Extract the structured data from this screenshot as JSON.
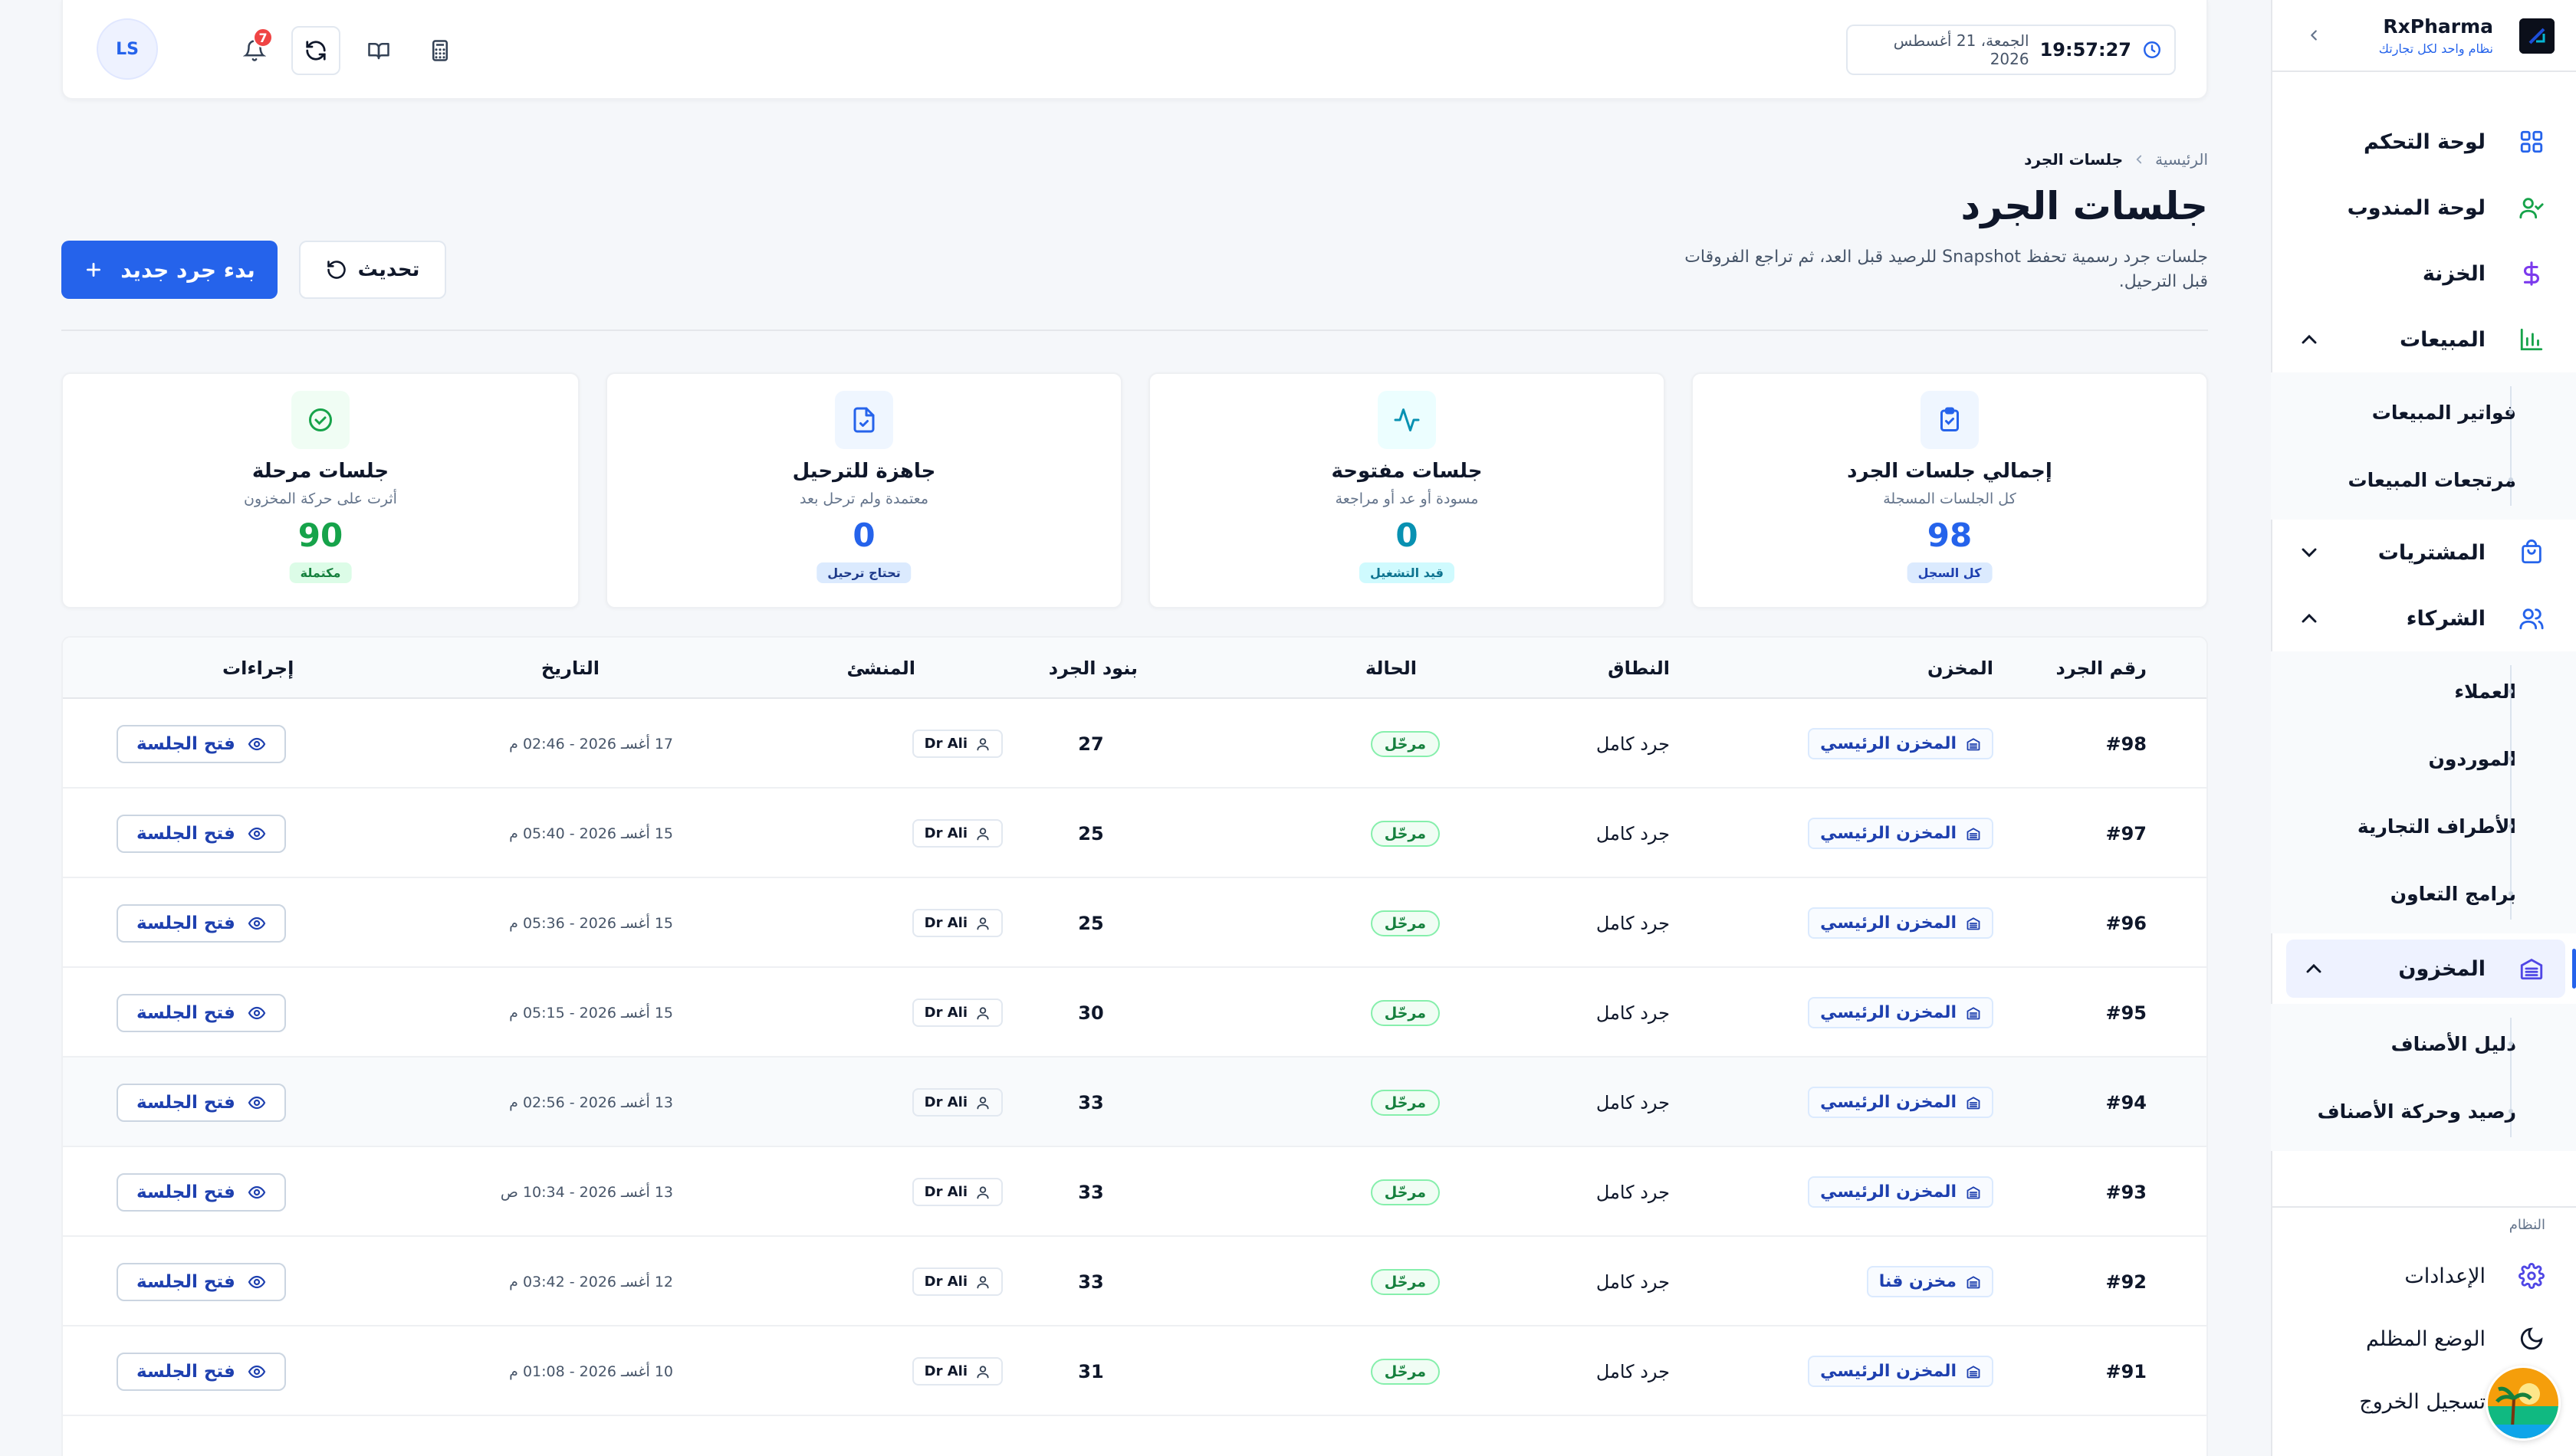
{
  "brand": {
    "name": "RxPharma",
    "tagline": "نظام واحد لكل تجارتك"
  },
  "nav": {
    "dashboard": "لوحة التحكم",
    "rep_dashboard": "لوحة المندوب",
    "treasury": "الخزنة",
    "sales": "المبيعات",
    "sales_items": [
      "فواتير المبيعات",
      "مرتجعات المبيعات"
    ],
    "purchases": "المشتريات",
    "partners": "الشركاء",
    "partners_items": [
      "العملاء",
      "الموردون",
      "الأطراف التجارية",
      "برامج التعاون"
    ],
    "inventory": "المخزون",
    "inventory_items": [
      "دليل الأصناف",
      "رصيد وحركة الأصناف"
    ],
    "system_label": "النظام",
    "settings": "الإعدادات",
    "dark_mode": "الوضع المظلم",
    "logout": "تسجيل الخروج"
  },
  "topbar": {
    "time": "19:57:27",
    "date": "الجمعة، 21 أغسطس 2026",
    "notifications_count": "7",
    "user_initials": "LS"
  },
  "page": {
    "breadcrumb_home": "الرئيسية",
    "breadcrumb_current": "جلسات الجرد",
    "title": "جلسات الجرد",
    "description": "جلسات جرد رسمية تحفظ Snapshot للرصيد قبل العد، ثم تراجع الفروقات قبل الترحيل.",
    "new_count_button": "بدء جرد جديد",
    "refresh_button": "تحديث"
  },
  "stats": [
    {
      "title": "إجمالي جلسات الجرد",
      "subtitle": "كل الجلسات المسجلة",
      "value": "98",
      "pill": "كل السجل",
      "color": "#2563eb",
      "bg": "#eff6ff",
      "pill_bg": "#dbeafe",
      "pill_color": "#1e40af",
      "icon": "clipboard-icon"
    },
    {
      "title": "جلسات مفتوحة",
      "subtitle": "مسودة أو عد أو مراجعة",
      "value": "0",
      "pill": "قيد التشغيل",
      "color": "#0891b2",
      "bg": "#ecfeff",
      "pill_bg": "#cffafe",
      "pill_color": "#0e7490",
      "icon": "activity-icon"
    },
    {
      "title": "جاهزة للترحيل",
      "subtitle": "معتمدة ولم ترحل بعد",
      "value": "0",
      "pill": "تحتاج ترحيل",
      "color": "#2563eb",
      "bg": "#eff6ff",
      "pill_bg": "#dbeafe",
      "pill_color": "#1e3a8a",
      "icon": "file-check-icon"
    },
    {
      "title": "جلسات مرحلة",
      "subtitle": "أثرت على حركة المخزون",
      "value": "90",
      "pill": "مكتملة",
      "color": "#16a34a",
      "bg": "#f0fdf4",
      "pill_bg": "#dcfce7",
      "pill_color": "#15803d",
      "icon": "check-circle-icon"
    }
  ],
  "table": {
    "headers": {
      "number": "رقم الجرد",
      "store": "المخزن",
      "scope": "النطاق",
      "status": "الحالة",
      "items": "بنود الجرد",
      "creator": "المنشئ",
      "date": "التاريخ",
      "actions": "إجراءات"
    },
    "open_label": "فتح الجلسة",
    "rows": [
      {
        "number": "#98",
        "store": "المخزن الرئيسي",
        "scope": "جرد كامل",
        "status": "مرحّل",
        "items": "27",
        "creator": "Dr Ali",
        "date": "17 أغسـ 2026 - 02:46 م"
      },
      {
        "number": "#97",
        "store": "المخزن الرئيسي",
        "scope": "جرد كامل",
        "status": "مرحّل",
        "items": "25",
        "creator": "Dr Ali",
        "date": "15 أغسـ 2026 - 05:40 م"
      },
      {
        "number": "#96",
        "store": "المخزن الرئيسي",
        "scope": "جرد كامل",
        "status": "مرحّل",
        "items": "25",
        "creator": "Dr Ali",
        "date": "15 أغسـ 2026 - 05:36 م"
      },
      {
        "number": "#95",
        "store": "المخزن الرئيسي",
        "scope": "جرد كامل",
        "status": "مرحّل",
        "items": "30",
        "creator": "Dr Ali",
        "date": "15 أغسـ 2026 - 05:15 م"
      },
      {
        "number": "#94",
        "store": "المخزن الرئيسي",
        "scope": "جرد كامل",
        "status": "مرحّل",
        "items": "33",
        "creator": "Dr Ali",
        "date": "13 أغسـ 2026 - 02:56 م"
      },
      {
        "number": "#93",
        "store": "المخزن الرئيسي",
        "scope": "جرد كامل",
        "status": "مرحّل",
        "items": "33",
        "creator": "Dr Ali",
        "date": "13 أغسـ 2026 - 10:34 ص"
      },
      {
        "number": "#92",
        "store": "مخزن قنا",
        "scope": "جرد كامل",
        "status": "مرحّل",
        "items": "33",
        "creator": "Dr Ali",
        "date": "12 أغسـ 2026 - 03:42 م"
      },
      {
        "number": "#91",
        "store": "المخزن الرئيسي",
        "scope": "جرد كامل",
        "status": "مرحّل",
        "items": "31",
        "creator": "Dr Ali",
        "date": "10 أغسـ 2026 - 01:08 م"
      }
    ]
  }
}
